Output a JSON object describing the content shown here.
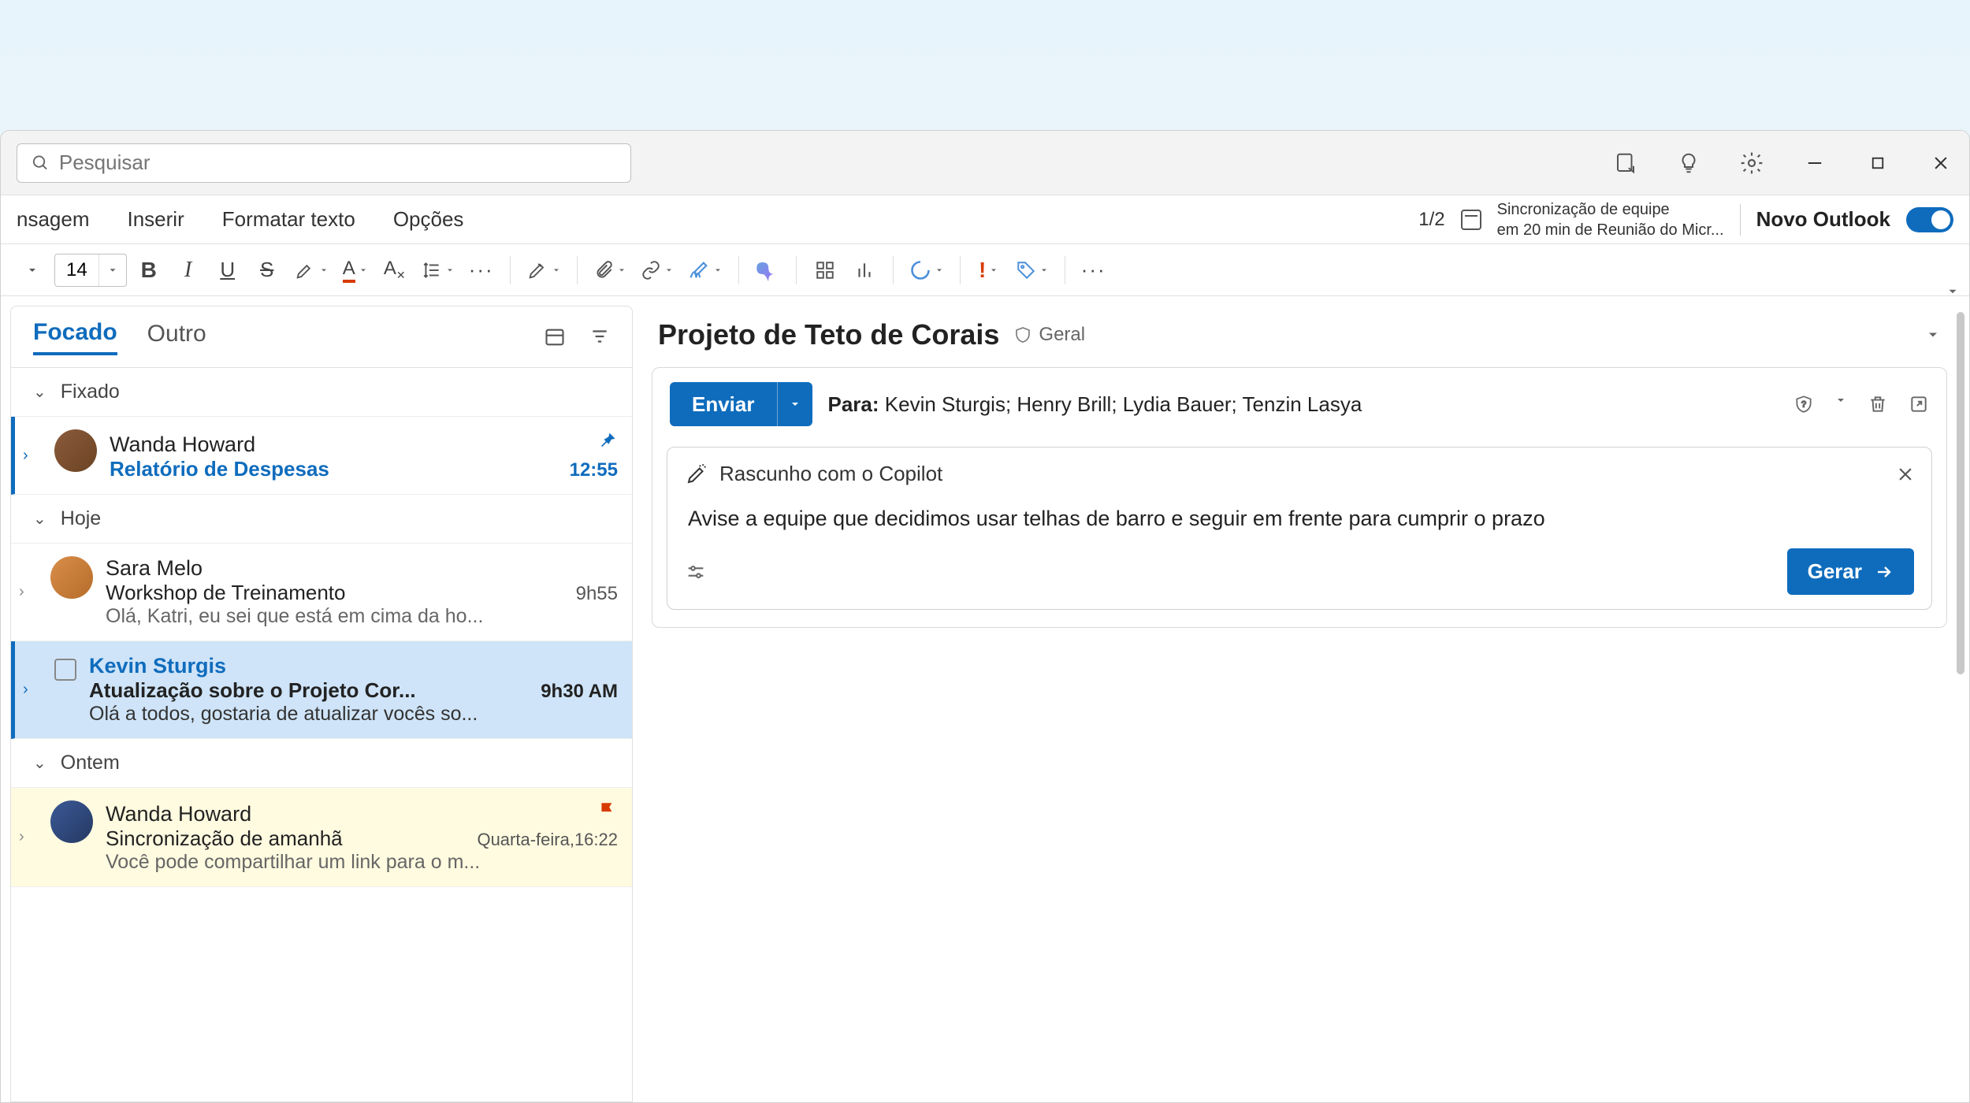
{
  "search": {
    "placeholder": "Pesquisar"
  },
  "ribbon": {
    "tabs": [
      "nsagem",
      "Inserir",
      "Formatar texto",
      "Opções"
    ],
    "page_indicator": "1/2",
    "sync_line1": "Sincronização de equipe",
    "sync_line2": "em 20 min de Reunião do Micr...",
    "new_outlook_label": "Novo Outlook"
  },
  "toolbar": {
    "font_size": "14"
  },
  "list": {
    "tabs": {
      "focused": "Focado",
      "other": "Outro"
    },
    "sections": {
      "pinned": "Fixado",
      "today": "Hoje",
      "yesterday": "Ontem"
    },
    "items": [
      {
        "from": "Wanda Howard",
        "subject": "Relatório de Despesas",
        "time": "12:55"
      },
      {
        "from": "Sara Melo",
        "subject": "Workshop de Treinamento",
        "preview": "Olá, Katri, eu sei que está em cima da ho...",
        "time": "9h55"
      },
      {
        "from": "Kevin Sturgis",
        "subject": "Atualização sobre o Projeto Cor...",
        "preview": "Olá a todos, gostaria de atualizar vocês so...",
        "time": "9h30 AM"
      },
      {
        "from": "Wanda Howard",
        "subject": "Sincronização de amanhã",
        "preview": "Você pode compartilhar um link para o m...",
        "time": "Quarta-feira,16:22"
      }
    ]
  },
  "thread": {
    "title": "Projeto de Teto de Corais",
    "tag": "Geral"
  },
  "compose": {
    "send": "Enviar",
    "to_label": "Para:",
    "to_value": "Kevin Sturgis; Henry Brill; Lydia Bauer; Tenzin Lasya"
  },
  "copilot": {
    "title": "Rascunho com o Copilot",
    "draft_text": "Avise a equipe que decidimos usar telhas de barro e seguir em frente para cumprir o prazo",
    "generate": "Gerar"
  }
}
